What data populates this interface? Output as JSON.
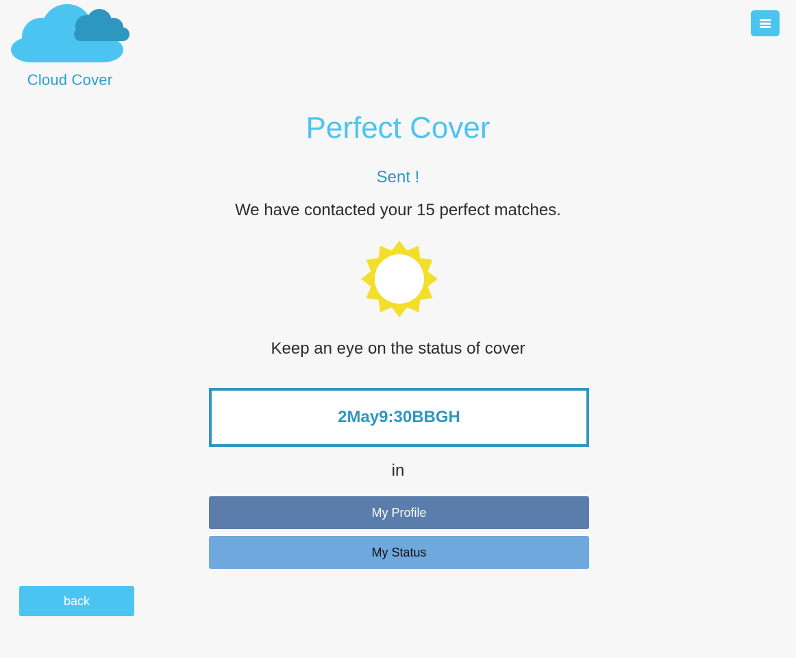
{
  "brand": {
    "name": "Cloud Cover",
    "logo_icon": "cloud-logo-icon",
    "colors": {
      "cloud_light": "#4cc4f2",
      "cloud_dark": "#2e97c0",
      "text": "#2a9fd6"
    }
  },
  "header": {
    "menu_icon": "hamburger-menu-icon",
    "menu_color": "#4cc4f2"
  },
  "main": {
    "title": "Perfect Cover",
    "status_heading": "Sent !",
    "message": "We have contacted your 15 perfect matches.",
    "sun_icon": "sun-icon",
    "sun_color": "#f4de2c",
    "keep_eye_text": "Keep an eye on the status of cover",
    "cover_code": "2May9:30BBGH",
    "in_text": "in"
  },
  "actions": {
    "my_profile_label": "My Profile",
    "my_status_label": "My Status",
    "back_label": "back"
  },
  "colors": {
    "accent": "#4cc4f2",
    "accent_dark": "#2e97c0",
    "profile_button": "#5b7dab",
    "status_button": "#6fa8dc",
    "background": "#f7f7f7"
  }
}
